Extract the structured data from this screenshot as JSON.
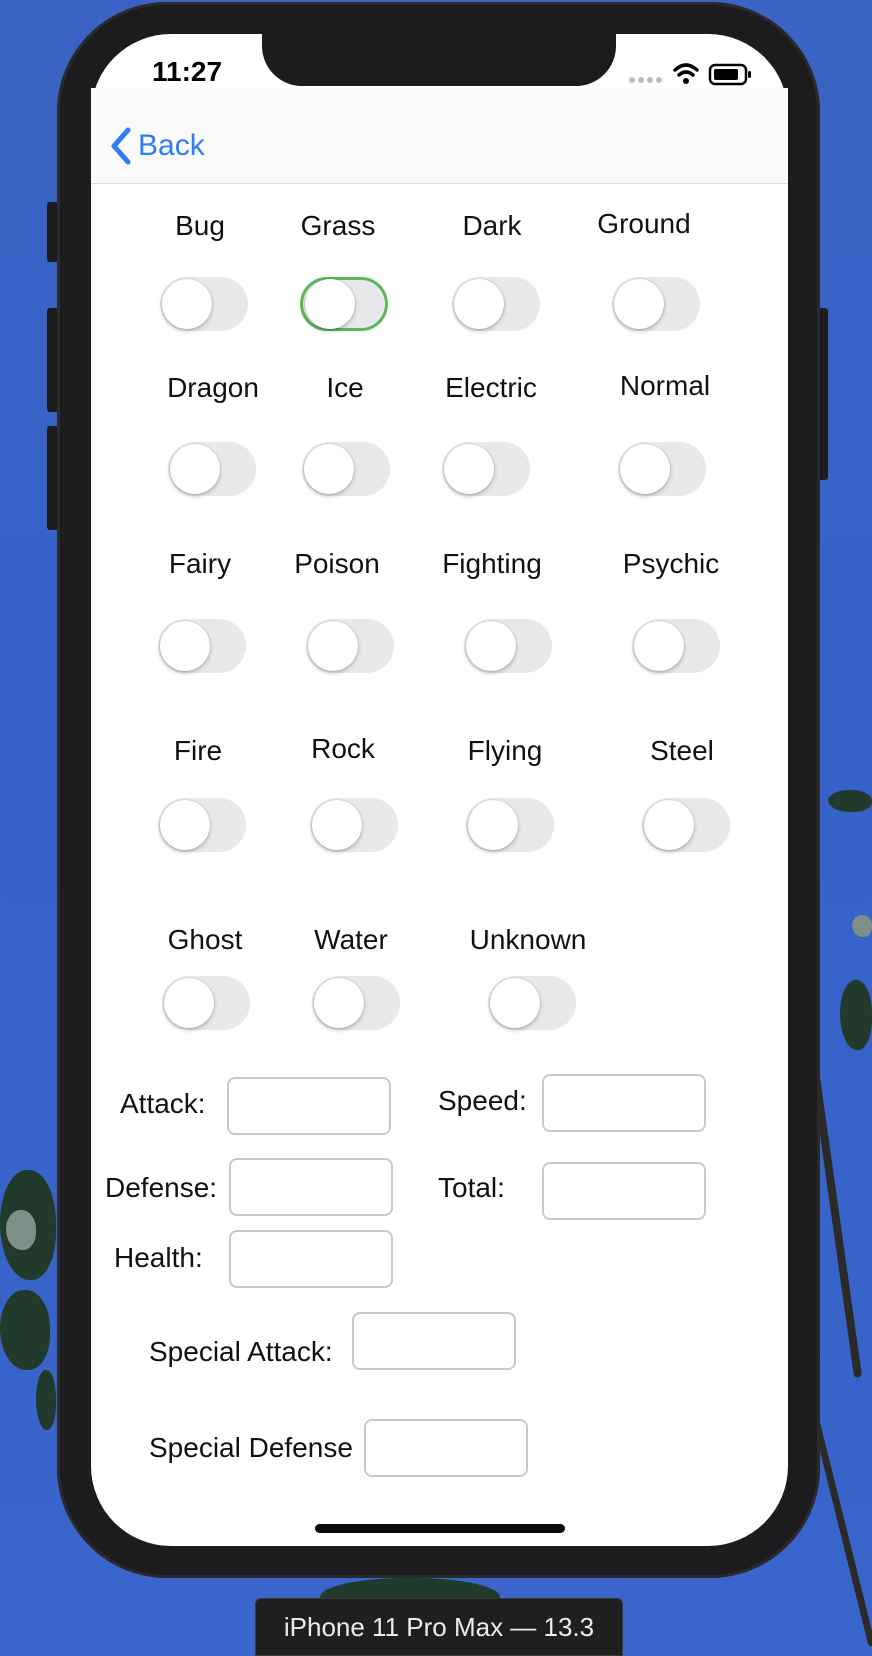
{
  "status_bar": {
    "time": "11:27"
  },
  "nav": {
    "back_label": "Back"
  },
  "types": [
    {
      "label": "Bug",
      "on": false
    },
    {
      "label": "Grass",
      "on": true
    },
    {
      "label": "Dark",
      "on": false
    },
    {
      "label": "Ground",
      "on": false
    },
    {
      "label": "Dragon",
      "on": false
    },
    {
      "label": "Ice",
      "on": false
    },
    {
      "label": "Electric",
      "on": false
    },
    {
      "label": "Normal",
      "on": false
    },
    {
      "label": "Fairy",
      "on": false
    },
    {
      "label": "Poison",
      "on": false
    },
    {
      "label": "Fighting",
      "on": false
    },
    {
      "label": "Psychic",
      "on": false
    },
    {
      "label": "Fire",
      "on": false
    },
    {
      "label": "Rock",
      "on": false
    },
    {
      "label": "Flying",
      "on": false
    },
    {
      "label": "Steel",
      "on": false
    },
    {
      "label": "Ghost",
      "on": false
    },
    {
      "label": "Water",
      "on": false
    },
    {
      "label": "Unknown",
      "on": false
    }
  ],
  "stats": {
    "attack": {
      "label": "Attack:",
      "value": ""
    },
    "speed": {
      "label": "Speed:",
      "value": ""
    },
    "defense": {
      "label": "Defense:",
      "value": ""
    },
    "total": {
      "label": "Total:",
      "value": ""
    },
    "health": {
      "label": "Health:",
      "value": ""
    },
    "special_attack": {
      "label": "Special Attack:",
      "value": ""
    },
    "special_defense": {
      "label": "Special Defense",
      "value": ""
    }
  },
  "simulator": {
    "device_label": "iPhone 11 Pro Max — 13.3"
  },
  "colors": {
    "accent": "#2f7cf6",
    "switch_on_border": "#5cb85c",
    "switch_track": "#e9e9eb",
    "desktop": "#3561c8"
  }
}
